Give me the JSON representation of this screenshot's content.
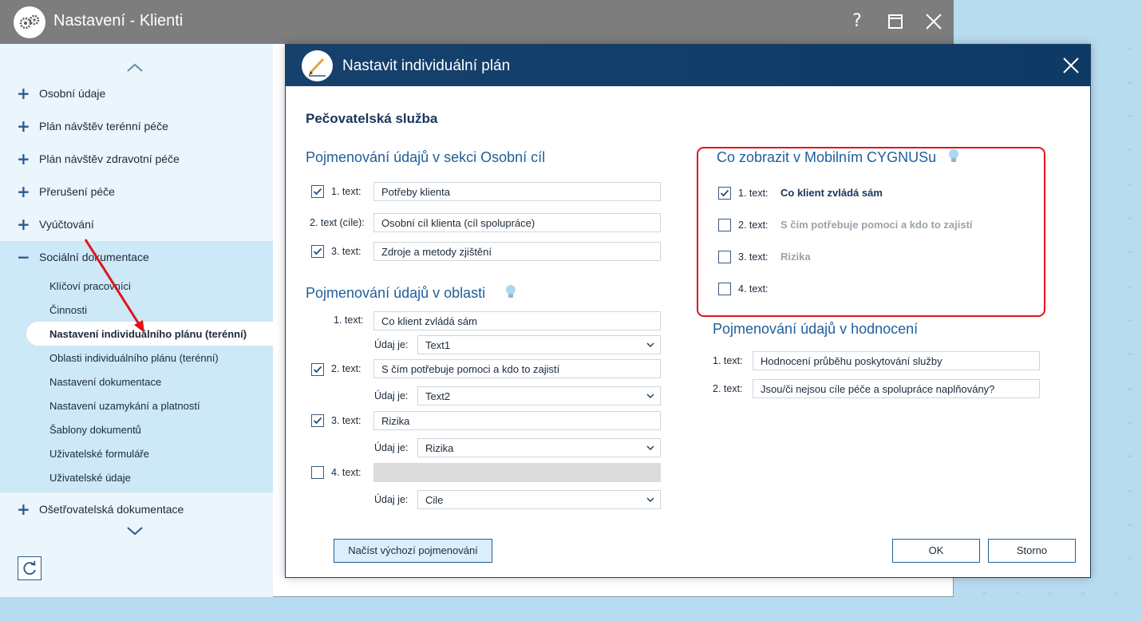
{
  "window": {
    "title": "Nastavení - Klienti",
    "help": "?",
    "maximize_icon": "maximize-icon",
    "close_icon": "close-icon"
  },
  "sidebar": {
    "items": [
      {
        "label": "Osobní údaje",
        "icon": "plus"
      },
      {
        "label": "Plán návštěv terénní péče",
        "icon": "plus"
      },
      {
        "label": "Plán návštěv zdravotní péče",
        "icon": "plus"
      },
      {
        "label": "Přerušení péče",
        "icon": "plus"
      },
      {
        "label": "Vyúčtování",
        "icon": "plus"
      },
      {
        "label": "Sociální dokumentace",
        "icon": "minus"
      },
      {
        "label": "Ošetřovatelská dokumentace",
        "icon": "plus"
      }
    ],
    "sub_items": [
      {
        "label": "Klíčoví pracovníci"
      },
      {
        "label": "Činnosti"
      },
      {
        "label": "Nastavení individuálního plánu (terénní)",
        "active": true
      },
      {
        "label": "Oblasti individuálního plánu (terénní)"
      },
      {
        "label": "Nastavení dokumentace"
      },
      {
        "label": "Nastavení uzamykání a platností"
      },
      {
        "label": "Šablony dokumentů"
      },
      {
        "label": "Uživatelské formuláře"
      },
      {
        "label": "Uživatelské údaje"
      }
    ]
  },
  "dialog": {
    "title": "Nastavit individuální plán",
    "service": "Pečovatelská služba",
    "personal_goal": {
      "heading": "Pojmenování údajů v sekci Osobní cíl",
      "rows": [
        {
          "label": "1. text:",
          "value": "Potřeby klienta",
          "checked": true
        },
        {
          "label": "2. text (cíle):",
          "value": "Osobní cíl klienta (cíl spolupráce)"
        },
        {
          "label": "3. text:",
          "value": "Zdroje a metody zjištění",
          "checked": true
        }
      ]
    },
    "area": {
      "heading": "Pojmenování údajů v oblasti",
      "data_label": "Údaj je:",
      "rows": [
        {
          "label": "1. text:",
          "value": "Co klient zvládá sám",
          "select": "Text1"
        },
        {
          "label": "2. text:",
          "value": "S čím potřebuje pomoci a kdo to zajistí",
          "checked": true,
          "select": "Text2"
        },
        {
          "label": "3. text:",
          "value": "Rizika",
          "checked": true,
          "select": "Rizika"
        },
        {
          "label": "4. text:",
          "value": "",
          "checked": false,
          "select": "Cile"
        }
      ]
    },
    "mobile": {
      "heading": "Co zobrazit v Mobilním CYGNUSu",
      "rows": [
        {
          "label": "1. text:",
          "value": "Co klient zvládá sám",
          "checked": true
        },
        {
          "label": "2. text:",
          "value": "S čím potřebuje pomoci a kdo to zajistí",
          "checked": false
        },
        {
          "label": "3. text:",
          "value": "Rizika",
          "checked": false
        },
        {
          "label": "4. text:",
          "value": "",
          "checked": false
        }
      ]
    },
    "evaluation": {
      "heading": "Pojmenování údajů v hodnocení",
      "rows": [
        {
          "label": "1. text:",
          "value": "Hodnocení průběhu poskytování služby"
        },
        {
          "label": "2. text:",
          "value": "Jsou/či nejsou cíle péče a spolupráce naplňovány?"
        }
      ]
    },
    "buttons": {
      "load_default": "Načíst výchozí pojmenování",
      "ok": "OK",
      "cancel": "Storno"
    }
  },
  "colors": {
    "dialog_header": "#0e3a66",
    "sidebar_bg": "#eaf5fc",
    "sidebar_active_group": "#cde8f7",
    "highlight": "#e0141e",
    "heading_blue": "#1f5f9a"
  }
}
